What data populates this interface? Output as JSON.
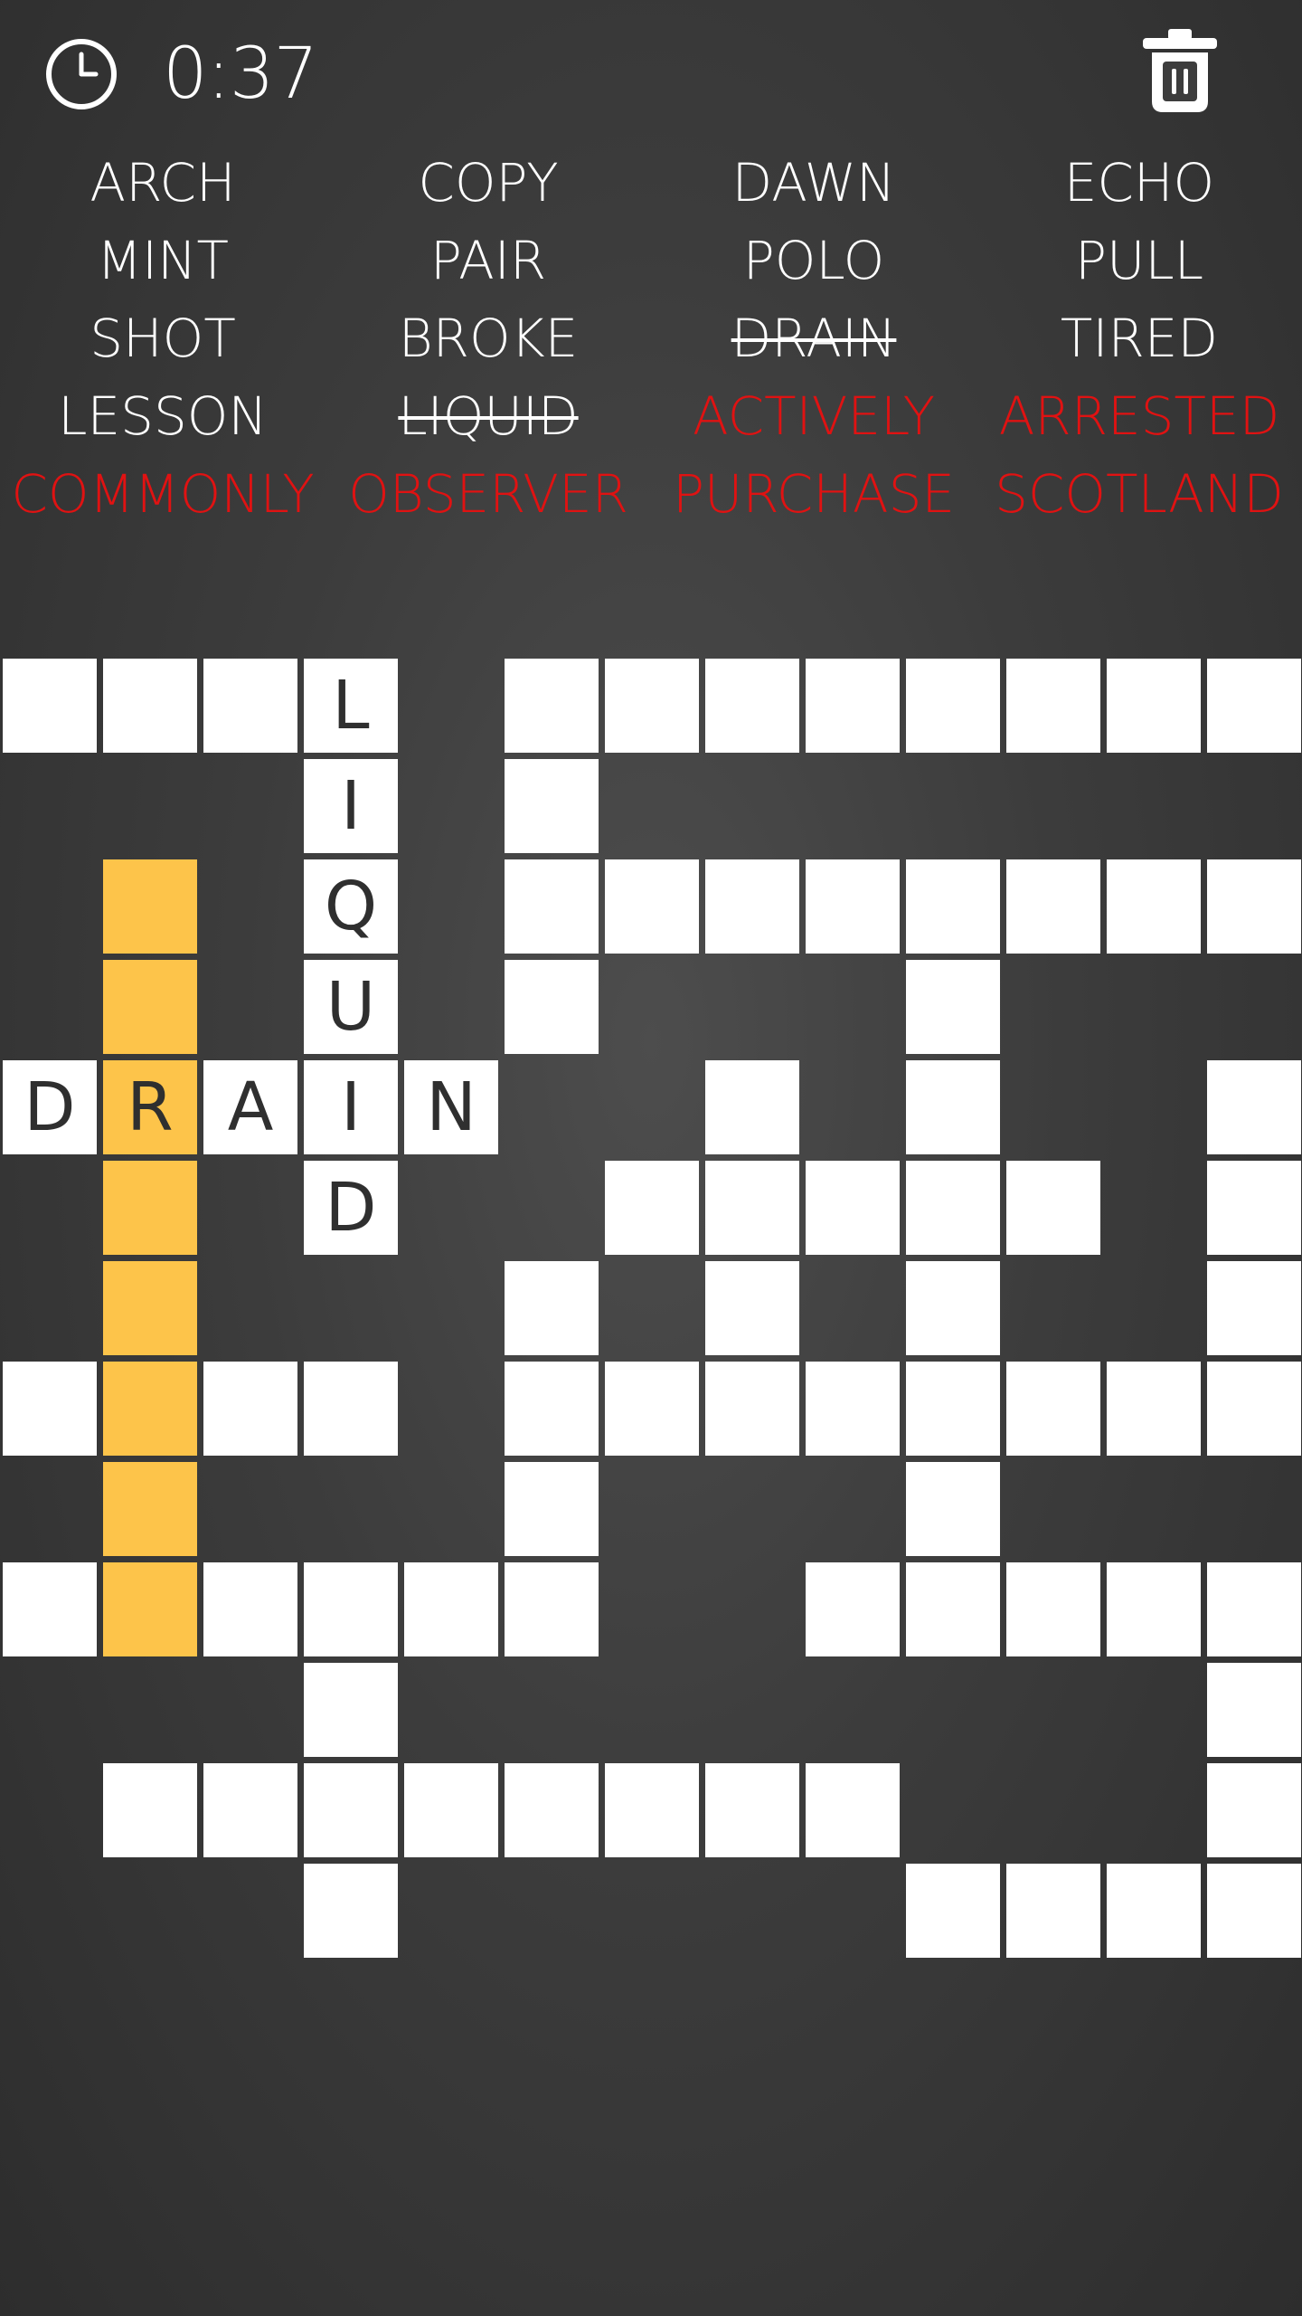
{
  "timer": {
    "icon": "clock-icon",
    "text": "0:37"
  },
  "toolbar": {
    "trash_icon": "trash-icon"
  },
  "colors": {
    "background": "#3d3d3d",
    "cell": "#ffffff",
    "highlight": "#fdc44a",
    "long_word": "#e01212",
    "text": "#ffffff",
    "cell_text": "#2f2f2f"
  },
  "words": [
    {
      "text": "ARCH",
      "state": "normal"
    },
    {
      "text": "COPY",
      "state": "normal"
    },
    {
      "text": "DAWN",
      "state": "normal"
    },
    {
      "text": "ECHO",
      "state": "normal"
    },
    {
      "text": "MINT",
      "state": "normal"
    },
    {
      "text": "PAIR",
      "state": "normal"
    },
    {
      "text": "POLO",
      "state": "normal"
    },
    {
      "text": "PULL",
      "state": "normal"
    },
    {
      "text": "SHOT",
      "state": "normal"
    },
    {
      "text": "BROKE",
      "state": "normal"
    },
    {
      "text": "DRAIN",
      "state": "found"
    },
    {
      "text": "TIRED",
      "state": "normal"
    },
    {
      "text": "LESSON",
      "state": "normal"
    },
    {
      "text": "LIQUID",
      "state": "found"
    },
    {
      "text": "ACTIVELY",
      "state": "long"
    },
    {
      "text": "ARRESTED",
      "state": "long"
    },
    {
      "text": "COMMONLY",
      "state": "long"
    },
    {
      "text": "OBSERVER",
      "state": "long"
    },
    {
      "text": "PURCHASE",
      "state": "long"
    },
    {
      "text": "SCOTLAND",
      "state": "long"
    }
  ],
  "grid": {
    "rows": [
      "WWWL.WWWWWWWW",
      "...I.W.......",
      ".H.Q.WWWWWWWW",
      ".H.U.W...W...",
      "DRAIN..W.W..W",
      ".H.D..WWWWW.W",
      ".H...W.W.W..W",
      "WHWW.WWWWWWWW",
      ".H...W...W...",
      "WHWWWW..WWWWW",
      "...W........W",
      ".WWWWWWWW...W",
      "...W.....WWWW"
    ]
  }
}
